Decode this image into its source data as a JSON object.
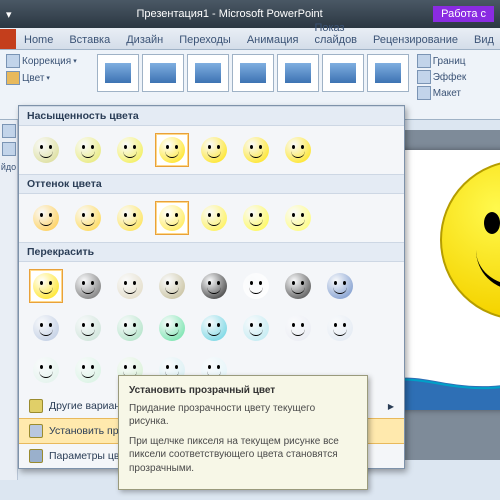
{
  "window": {
    "title": "Презентация1 - Microsoft PowerPoint",
    "tools_tab": "Работа с"
  },
  "tabs": {
    "home": "Home",
    "insert": "Вставка",
    "design": "Дизайн",
    "transitions": "Переходы",
    "animation": "Анимация",
    "slideshow": "Показ слайдов",
    "review": "Рецензирование",
    "view": "Вид"
  },
  "ribbon": {
    "correction": "Коррекция",
    "color": "Цвет",
    "border": "Границ",
    "effects": "Эффек",
    "layout": "Макет",
    "hidden_edge": "йдо"
  },
  "panel": {
    "saturation": "Насыщенность цвета",
    "tone": "Оттенок цвета",
    "recolor": "Перекрасить",
    "more": "Другие варианты",
    "transparent": "Установить прозрачный цвет",
    "params": "Параметры цве",
    "sat_colors": [
      "#d7d98a",
      "#e5e765",
      "#f2ed3f",
      "#ffe100",
      "#ffe100",
      "#ffe100",
      "#ffe100"
    ],
    "tone_colors": [
      "#ffc83d",
      "#ffd43d",
      "#ffe03d",
      "#ffe83d",
      "#fff03d",
      "#fff83d",
      "#fffc6a"
    ],
    "recolor_rows": [
      [
        "#ffe100",
        "#666666",
        "#e0d8c0",
        "#c0b890",
        "#222222",
        "#ffffff",
        "#3a3a3a"
      ],
      [
        "#6a8cc7",
        "#b8c7e0",
        "#c7e0d4",
        "#a7e0c0",
        "#60e0a0",
        "#60d0e0",
        "#b8e8f0"
      ],
      [
        "#e8eaf2",
        "#e0e8f2",
        "#e0f2ea",
        "#d4f2e0",
        "#d4f0d0",
        "#d4eef2",
        "#e0f4f8"
      ]
    ]
  },
  "tooltip": {
    "title": "Установить прозрачный цвет",
    "line1": "Придание прозрачности цвету текущего рисунка.",
    "line2": "При щелчке пикселя на текущем рисунке все пиксели соответствующего цвета становятся прозрачными."
  }
}
